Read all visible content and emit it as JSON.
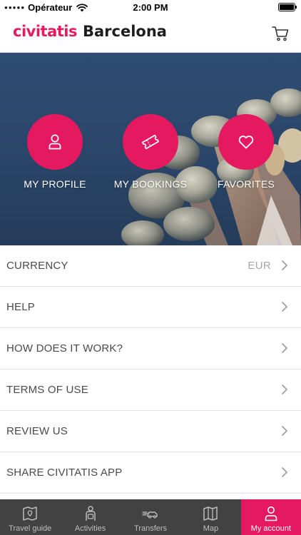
{
  "status_bar": {
    "carrier": "Opérateur",
    "time": "2:00 PM"
  },
  "header": {
    "brand": "civitatis",
    "city": "Barcelona",
    "cart_icon": "cart-icon"
  },
  "hero": {
    "actions": [
      {
        "label": "MY PROFILE",
        "icon": "user-icon"
      },
      {
        "label": "MY BOOKINGS",
        "icon": "ticket-icon"
      },
      {
        "label": "FAVORITES",
        "icon": "heart-icon"
      }
    ]
  },
  "menu": {
    "items": [
      {
        "label": "CURRENCY",
        "value": "EUR"
      },
      {
        "label": "HELP"
      },
      {
        "label": "HOW DOES IT WORK?"
      },
      {
        "label": "TERMS OF USE"
      },
      {
        "label": "REVIEW US"
      },
      {
        "label": "SHARE CIVITATIS APP"
      }
    ]
  },
  "tab_bar": {
    "tabs": [
      {
        "label": "Travel guide",
        "icon": "map-book-icon"
      },
      {
        "label": "Activities",
        "icon": "guide-person-icon"
      },
      {
        "label": "Transfers",
        "icon": "transfer-car-icon"
      },
      {
        "label": "Map",
        "icon": "map-icon"
      },
      {
        "label": "My account",
        "icon": "user-icon",
        "active": true
      }
    ]
  },
  "colors": {
    "brand_pink": "#e5195f",
    "tab_bar_bg": "#424242",
    "hero_bg": "#2f4c73"
  }
}
